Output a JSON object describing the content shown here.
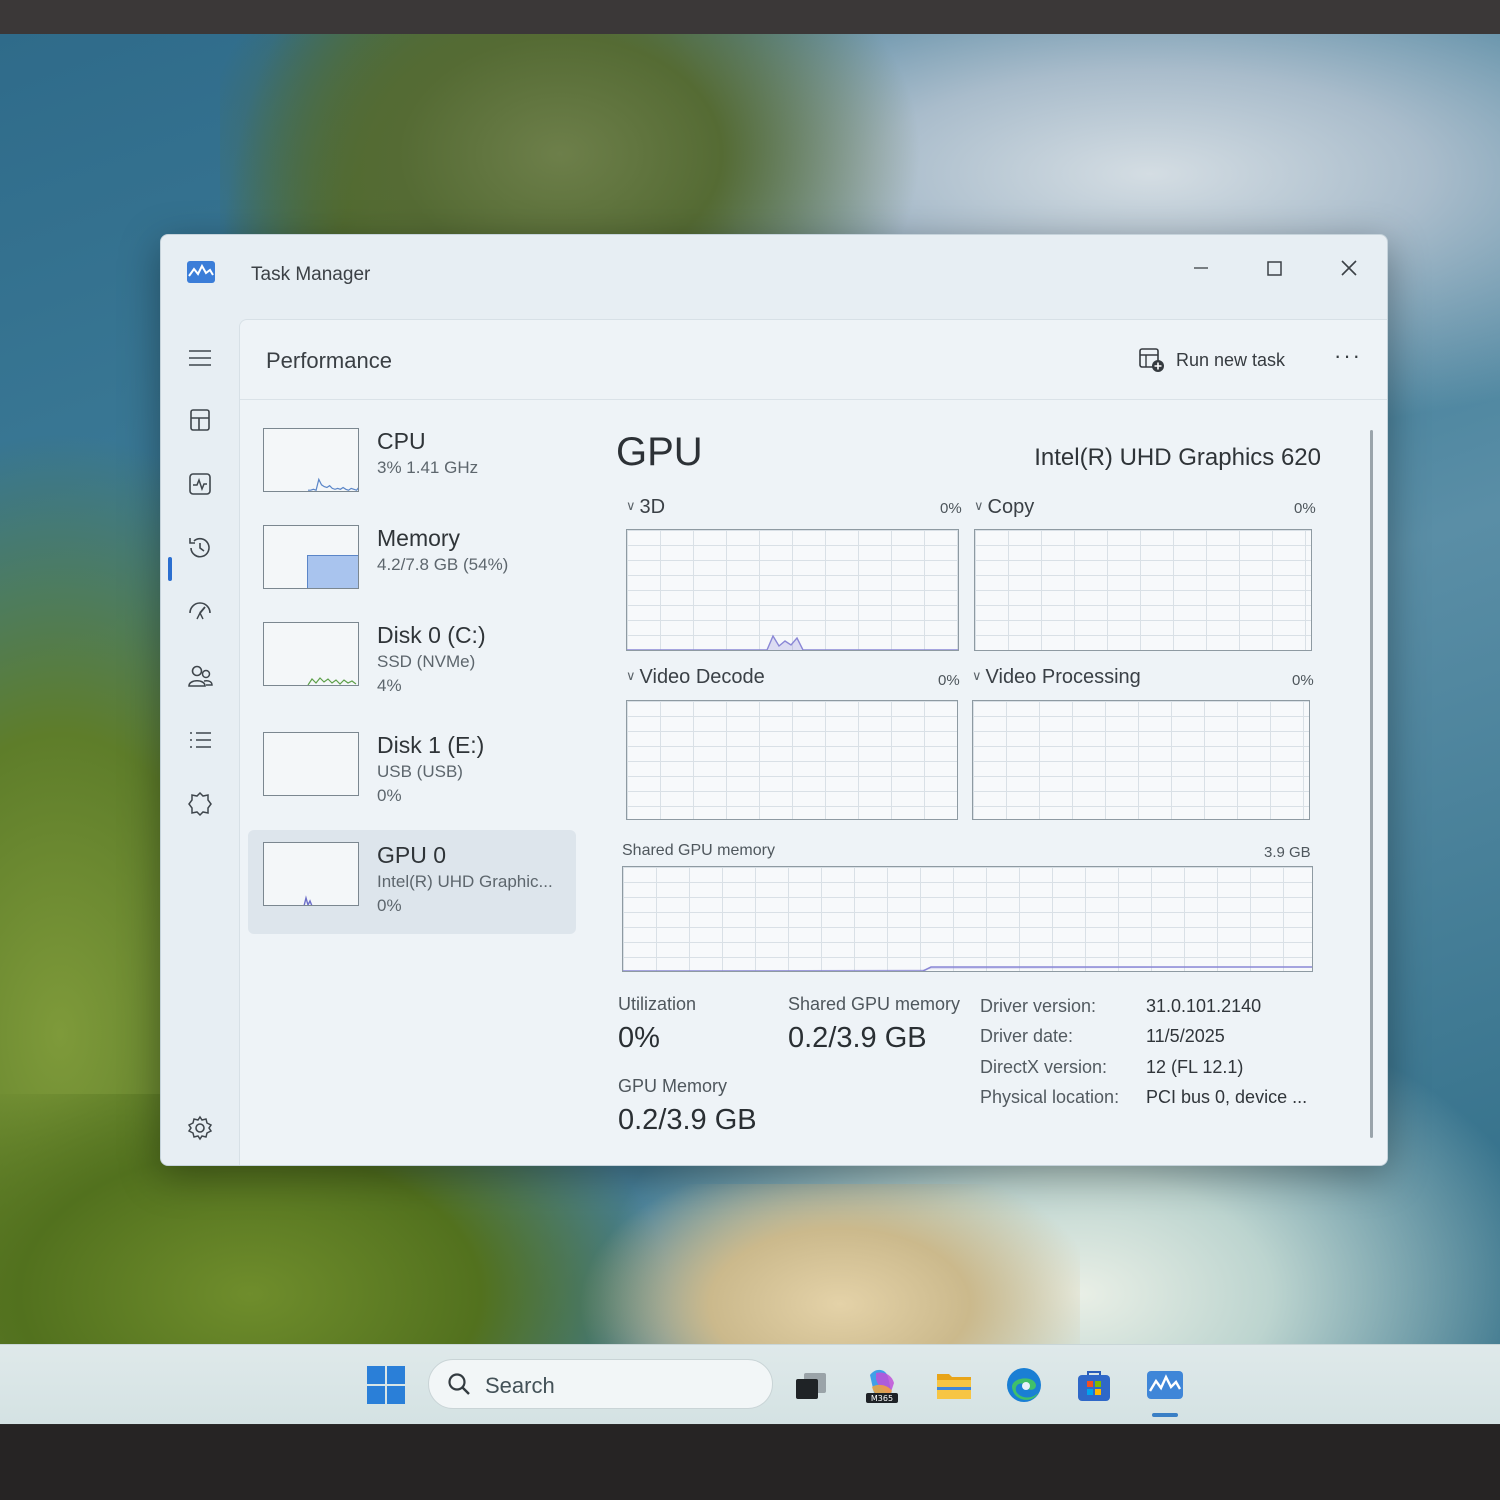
{
  "window": {
    "title": "Task Manager",
    "controls": {
      "minimize": "minimize-icon",
      "maximize": "maximize-icon",
      "close": "close-icon"
    }
  },
  "nav": {
    "items": [
      {
        "icon": "hamburger-menu-icon"
      },
      {
        "icon": "processes-icon"
      },
      {
        "icon": "performance-icon",
        "active": true
      },
      {
        "icon": "app-history-icon"
      },
      {
        "icon": "startup-apps-icon"
      },
      {
        "icon": "users-icon"
      },
      {
        "icon": "details-icon"
      },
      {
        "icon": "services-icon"
      },
      {
        "icon": "settings-icon"
      }
    ]
  },
  "header": {
    "title": "Performance",
    "run_new_task": "Run new task",
    "more": "···"
  },
  "devices": [
    {
      "name": "CPU",
      "sub": "3% 1.41 GHz",
      "sub2": ""
    },
    {
      "name": "Memory",
      "sub": "4.2/7.8 GB (54%)",
      "sub2": "",
      "fill_fraction": 0.54
    },
    {
      "name": "Disk 0 (C:)",
      "sub": "SSD (NVMe)",
      "sub2": "4%"
    },
    {
      "name": "Disk 1 (E:)",
      "sub": "USB (USB)",
      "sub2": "0%"
    },
    {
      "name": "GPU 0",
      "sub": "Intel(R) UHD Graphic...",
      "sub2": "0%",
      "selected": true
    }
  ],
  "gpu": {
    "title": "GPU",
    "model": "Intel(R) UHD Graphics 620",
    "engines": [
      {
        "label": "3D",
        "percent": "0%"
      },
      {
        "label": "Copy",
        "percent": "0%"
      },
      {
        "label": "Video Decode",
        "percent": "0%"
      },
      {
        "label": "Video Processing",
        "percent": "0%"
      }
    ],
    "shared_memory_graph": {
      "label": "Shared GPU memory",
      "max": "3.9 GB"
    },
    "stats": {
      "utilization_label": "Utilization",
      "utilization_value": "0%",
      "shared_label": "Shared GPU memory",
      "shared_value": "0.2/3.9 GB",
      "gpu_memory_label": "GPU Memory",
      "gpu_memory_value": "0.2/3.9 GB"
    },
    "info": [
      {
        "label": "Driver version:",
        "value": "31.0.101.2140"
      },
      {
        "label": "Driver date:",
        "value": "11/5/2025"
      },
      {
        "label": "DirectX version:",
        "value": "12 (FL 12.1)"
      },
      {
        "label": "Physical location:",
        "value": "PCI bus 0, device ..."
      }
    ]
  },
  "taskbar": {
    "search_placeholder": "Search",
    "apps": [
      "windows-start-icon",
      "search-icon",
      "task-view-icon",
      "microsoft-365-copilot-icon",
      "file-explorer-icon",
      "edge-icon",
      "microsoft-store-icon",
      "task-manager-icon"
    ],
    "m365_badge": "M365"
  },
  "colors": {
    "accent": "#2b6fd0",
    "graph_line": "#8a87d6",
    "memory_fill": "#a9c4ee"
  }
}
